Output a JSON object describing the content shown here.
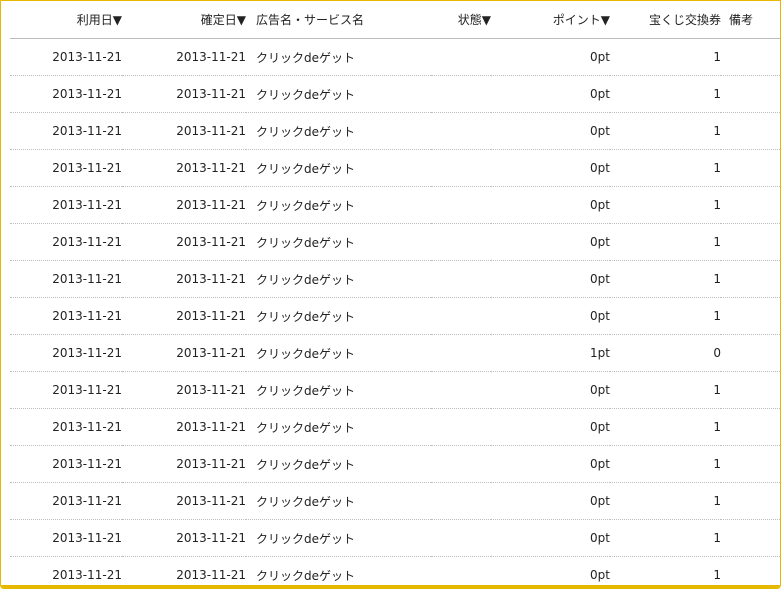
{
  "columns": {
    "use_date": "利用日▼",
    "confirm_date": "確定日▼",
    "ad_name": "広告名・サービス名",
    "status": "状態▼",
    "points": "ポイント▼",
    "lottery": "宝くじ交換券",
    "note": "備考"
  },
  "rows": [
    {
      "use_date": "2013-11-21",
      "confirm_date": "2013-11-21",
      "ad_name": "クリックdeゲット",
      "status": "",
      "points": "0pt",
      "lottery": "1",
      "note": ""
    },
    {
      "use_date": "2013-11-21",
      "confirm_date": "2013-11-21",
      "ad_name": "クリックdeゲット",
      "status": "",
      "points": "0pt",
      "lottery": "1",
      "note": ""
    },
    {
      "use_date": "2013-11-21",
      "confirm_date": "2013-11-21",
      "ad_name": "クリックdeゲット",
      "status": "",
      "points": "0pt",
      "lottery": "1",
      "note": ""
    },
    {
      "use_date": "2013-11-21",
      "confirm_date": "2013-11-21",
      "ad_name": "クリックdeゲット",
      "status": "",
      "points": "0pt",
      "lottery": "1",
      "note": ""
    },
    {
      "use_date": "2013-11-21",
      "confirm_date": "2013-11-21",
      "ad_name": "クリックdeゲット",
      "status": "",
      "points": "0pt",
      "lottery": "1",
      "note": ""
    },
    {
      "use_date": "2013-11-21",
      "confirm_date": "2013-11-21",
      "ad_name": "クリックdeゲット",
      "status": "",
      "points": "0pt",
      "lottery": "1",
      "note": ""
    },
    {
      "use_date": "2013-11-21",
      "confirm_date": "2013-11-21",
      "ad_name": "クリックdeゲット",
      "status": "",
      "points": "0pt",
      "lottery": "1",
      "note": ""
    },
    {
      "use_date": "2013-11-21",
      "confirm_date": "2013-11-21",
      "ad_name": "クリックdeゲット",
      "status": "",
      "points": "0pt",
      "lottery": "1",
      "note": ""
    },
    {
      "use_date": "2013-11-21",
      "confirm_date": "2013-11-21",
      "ad_name": "クリックdeゲット",
      "status": "",
      "points": "1pt",
      "lottery": "0",
      "note": ""
    },
    {
      "use_date": "2013-11-21",
      "confirm_date": "2013-11-21",
      "ad_name": "クリックdeゲット",
      "status": "",
      "points": "0pt",
      "lottery": "1",
      "note": ""
    },
    {
      "use_date": "2013-11-21",
      "confirm_date": "2013-11-21",
      "ad_name": "クリックdeゲット",
      "status": "",
      "points": "0pt",
      "lottery": "1",
      "note": ""
    },
    {
      "use_date": "2013-11-21",
      "confirm_date": "2013-11-21",
      "ad_name": "クリックdeゲット",
      "status": "",
      "points": "0pt",
      "lottery": "1",
      "note": ""
    },
    {
      "use_date": "2013-11-21",
      "confirm_date": "2013-11-21",
      "ad_name": "クリックdeゲット",
      "status": "",
      "points": "0pt",
      "lottery": "1",
      "note": ""
    },
    {
      "use_date": "2013-11-21",
      "confirm_date": "2013-11-21",
      "ad_name": "クリックdeゲット",
      "status": "",
      "points": "0pt",
      "lottery": "1",
      "note": ""
    },
    {
      "use_date": "2013-11-21",
      "confirm_date": "2013-11-21",
      "ad_name": "クリックdeゲット",
      "status": "",
      "points": "0pt",
      "lottery": "1",
      "note": ""
    }
  ],
  "colors": {
    "frame_border": "#e6b800",
    "header_rule": "#bbbbbb",
    "row_rule": "#bdbdbd"
  }
}
